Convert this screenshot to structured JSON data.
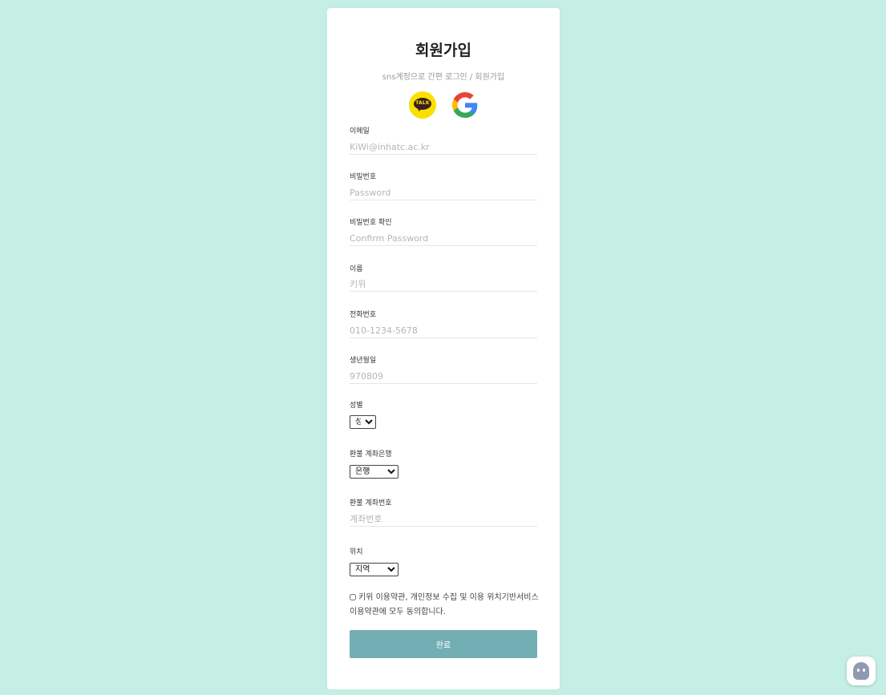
{
  "form": {
    "title": "회원가입",
    "subtitle": "sns계정으로 간편 로그인 / 회원가입",
    "social": {
      "kakao_text": "TALK",
      "kakao_icon": "kakao-talk-icon",
      "google_icon": "google-icon"
    },
    "fields": {
      "email": {
        "label": "이메일",
        "placeholder": "KiWi@inhatc.ac.kr"
      },
      "password": {
        "label": "비밀번호",
        "placeholder": "Password"
      },
      "password_confirm": {
        "label": "비밀번호 확인",
        "placeholder": "Confirm Password"
      },
      "name": {
        "label": "이름",
        "placeholder": "키위"
      },
      "phone": {
        "label": "전화번호",
        "placeholder": "010-1234-5678"
      },
      "birth": {
        "label": "생년월일",
        "placeholder": "970809"
      },
      "gender": {
        "label": "성별",
        "selected": "성별"
      },
      "bank": {
        "label": "환불 계좌은행",
        "selected": "은행"
      },
      "account": {
        "label": "환불 계좌번호",
        "placeholder": "계좌번호"
      },
      "location": {
        "label": "위치",
        "selected": "지역"
      }
    },
    "agree_text": "키위 이용약관, 개인정보 수집 및 이용 위치기반서비스 이용약관에 모두 동의합니다.",
    "submit_label": "완료"
  },
  "colors": {
    "background": "#c5efe4",
    "submit": "#72aeb4",
    "kakao": "#f9e000"
  }
}
